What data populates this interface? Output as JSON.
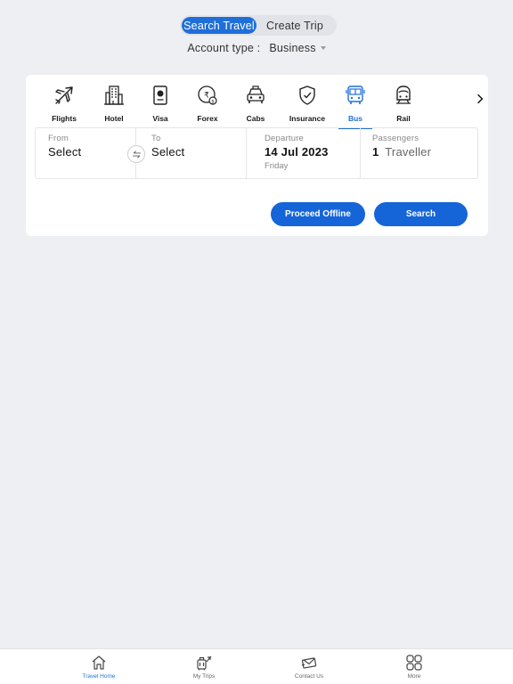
{
  "mode_toggle": {
    "active": "Search Travel",
    "inactive": "Create Trip"
  },
  "account": {
    "label": "Account type :",
    "value": "Business"
  },
  "categories": [
    {
      "label": "Flights",
      "icon": "plane-icon"
    },
    {
      "label": "Hotel",
      "icon": "building-icon"
    },
    {
      "label": "Visa",
      "icon": "passport-icon"
    },
    {
      "label": "Forex",
      "icon": "currency-icon"
    },
    {
      "label": "Cabs",
      "icon": "taxi-icon"
    },
    {
      "label": "Insurance",
      "icon": "shield-icon"
    },
    {
      "label": "Bus",
      "icon": "bus-icon",
      "active": true
    },
    {
      "label": "Rail",
      "icon": "train-icon"
    }
  ],
  "form": {
    "from": {
      "caption": "From",
      "value": "Select"
    },
    "to": {
      "caption": "To",
      "value": "Select"
    },
    "departure": {
      "caption": "Departure",
      "date": "14 Jul 2023",
      "day": "Friday"
    },
    "passengers": {
      "caption": "Passengers",
      "count": "1",
      "unit": "Traveller"
    }
  },
  "buttons": {
    "offline": "Proceed Offline",
    "search": "Search"
  },
  "bottom_nav": [
    {
      "label": "Travel Home",
      "icon": "home-icon",
      "active": true
    },
    {
      "label": "My Trips",
      "icon": "luggage-icon"
    },
    {
      "label": "Contact Us",
      "icon": "envelope-icon"
    },
    {
      "label": "More",
      "icon": "grid-icon"
    }
  ],
  "colors": {
    "accent": "#1f6fd9",
    "button": "#1565d8",
    "background": "#eeeff3"
  }
}
